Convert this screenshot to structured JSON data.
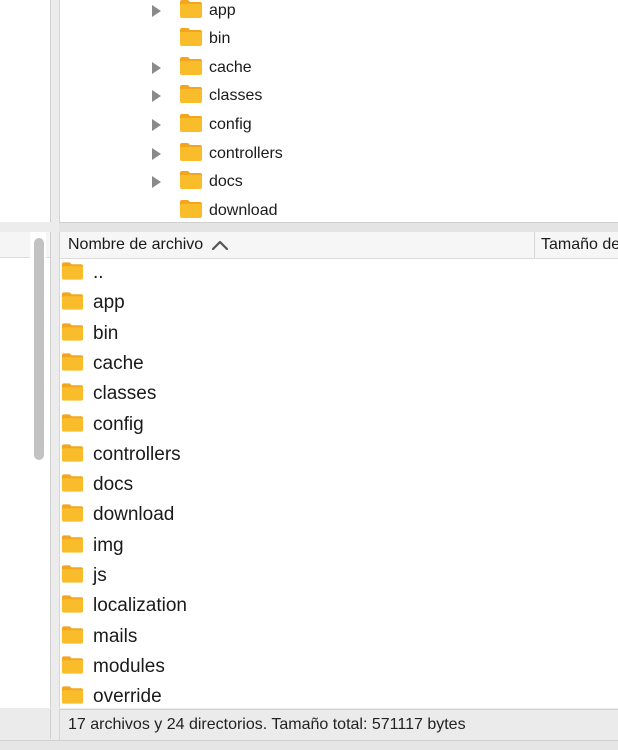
{
  "colors": {
    "folder": "#f9bd2b",
    "folder_tab": "#f3a51d",
    "arrow": "#8a8a8a"
  },
  "tree": {
    "items": [
      {
        "label": "app",
        "expandable": true
      },
      {
        "label": "bin",
        "expandable": false
      },
      {
        "label": "cache",
        "expandable": true
      },
      {
        "label": "classes",
        "expandable": true
      },
      {
        "label": "config",
        "expandable": true
      },
      {
        "label": "controllers",
        "expandable": true
      },
      {
        "label": "docs",
        "expandable": true
      },
      {
        "label": "download",
        "expandable": false
      }
    ]
  },
  "file_list": {
    "columns": {
      "name": "Nombre de archivo",
      "size": "Tamaño de"
    },
    "sort_icon": "chevron-up-icon",
    "rows": [
      "..",
      "app",
      "bin",
      "cache",
      "classes",
      "config",
      "controllers",
      "docs",
      "download",
      "img",
      "js",
      "localization",
      "mails",
      "modules",
      "override"
    ]
  },
  "status": {
    "text": "17 archivos y 24 directorios. Tamaño total: 571117 bytes"
  }
}
